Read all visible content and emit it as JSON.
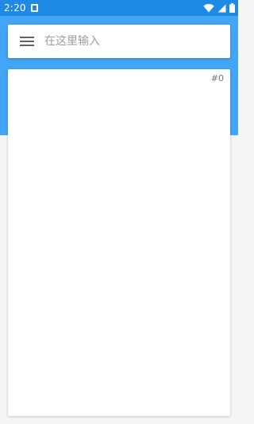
{
  "status_bar": {
    "time": "2:20",
    "icons": [
      "notification-icon",
      "wifi-icon",
      "signal-icon",
      "battery-icon"
    ],
    "color": "#1f8ae6"
  },
  "header": {
    "color": "#42a5f5"
  },
  "search": {
    "menu_icon": "menu-icon",
    "placeholder": "在这里输入",
    "value": ""
  },
  "card": {
    "counter": "#0"
  }
}
